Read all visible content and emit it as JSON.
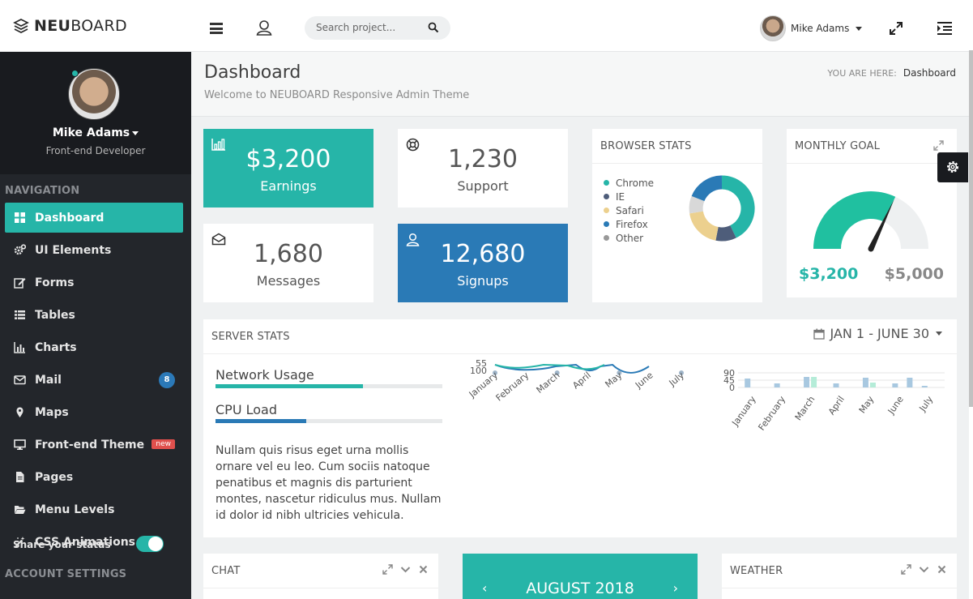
{
  "brand": {
    "bold": "NEU",
    "rest": "BOARD"
  },
  "search": {
    "placeholder": "Search project..."
  },
  "top_user": {
    "name": "Mike Adams"
  },
  "sidebar": {
    "name": "Mike Adams",
    "role": "Front-end Developer",
    "nav_heading": "NAVIGATION",
    "items": [
      {
        "label": "Dashboard",
        "icon": "dashboard-icon"
      },
      {
        "label": "UI Elements",
        "icon": "cogs-icon"
      },
      {
        "label": "Forms",
        "icon": "edit-icon"
      },
      {
        "label": "Tables",
        "icon": "table-icon"
      },
      {
        "label": "Charts",
        "icon": "bar-chart-icon"
      },
      {
        "label": "Mail",
        "icon": "envelope-icon",
        "badge": "8"
      },
      {
        "label": "Maps",
        "icon": "map-marker-icon"
      },
      {
        "label": "Front-end Theme",
        "icon": "desktop-icon",
        "tag": "new"
      },
      {
        "label": "Pages",
        "icon": "file-icon"
      },
      {
        "label": "Menu Levels",
        "icon": "folder-open-icon"
      },
      {
        "label": "CSS Animations",
        "icon": "magic-icon"
      }
    ],
    "account_heading": "ACCOUNT SETTINGS",
    "share_status": "Share your status"
  },
  "page": {
    "title": "Dashboard",
    "subtitle": "Welcome to NEUBOARD Responsive Admin Theme",
    "crumb_label": "YOU ARE HERE:",
    "crumb_current": "Dashboard"
  },
  "tiles": {
    "earnings": {
      "value": "$3,200",
      "label": "Earnings"
    },
    "support": {
      "value": "1,230",
      "label": "Support"
    },
    "messages": {
      "value": "1,680",
      "label": "Messages"
    },
    "signups": {
      "value": "12,680",
      "label": "Signups"
    }
  },
  "browser_stats": {
    "title": "BROWSER STATS",
    "legend": [
      {
        "name": "Chrome",
        "color": "#26b5a8"
      },
      {
        "name": "IE",
        "color": "#4e5d7a"
      },
      {
        "name": "Safari",
        "color": "#ecd08e"
      },
      {
        "name": "Firefox",
        "color": "#2a7ab6"
      },
      {
        "name": "Other",
        "color": "#999999"
      }
    ]
  },
  "monthly_goal": {
    "title": "MONTHLY GOAL",
    "current": "$3,200",
    "target": "$5,000",
    "fraction": 0.64
  },
  "server_stats": {
    "title": "SERVER STATS",
    "date_range": "JAN 1 - JUNE 30",
    "network_label": "Network Usage",
    "network_pct": 65,
    "cpu_label": "CPU Load",
    "cpu_pct": 40,
    "text": "Nullam quis risus eget urna mollis ornare vel eu leo. Cum sociis natoque penatibus et magnis dis parturient montes, nascetur ridiculus mus. Nullam id dolor id nibh ultricies vehicula.",
    "colors": {
      "teal": "#26b5a8",
      "blue": "#2a7ab6"
    }
  },
  "chat": {
    "title": "CHAT"
  },
  "calendar": {
    "title": "AUGUST 2018",
    "prev": "‹",
    "next": "›"
  },
  "weather": {
    "title": "WEATHER"
  },
  "chart_data": [
    {
      "type": "line",
      "categories": [
        "January",
        "February",
        "March",
        "April",
        "May",
        "June",
        "July"
      ],
      "yticks": [
        "100",
        "55"
      ]
    },
    {
      "type": "bar",
      "categories": [
        "January",
        "February",
        "March",
        "April",
        "May",
        "June",
        "July"
      ],
      "yticks": [
        "90",
        "45",
        "0"
      ],
      "series": [
        {
          "values": [
            55,
            25,
            65,
            25,
            60,
            25,
            10
          ]
        },
        {
          "values": [
            0,
            0,
            65,
            0,
            30,
            0,
            0
          ]
        },
        {
          "values": [
            0,
            0,
            0,
            0,
            0,
            60,
            0
          ]
        }
      ],
      "ylim": [
        0,
        90
      ]
    }
  ]
}
